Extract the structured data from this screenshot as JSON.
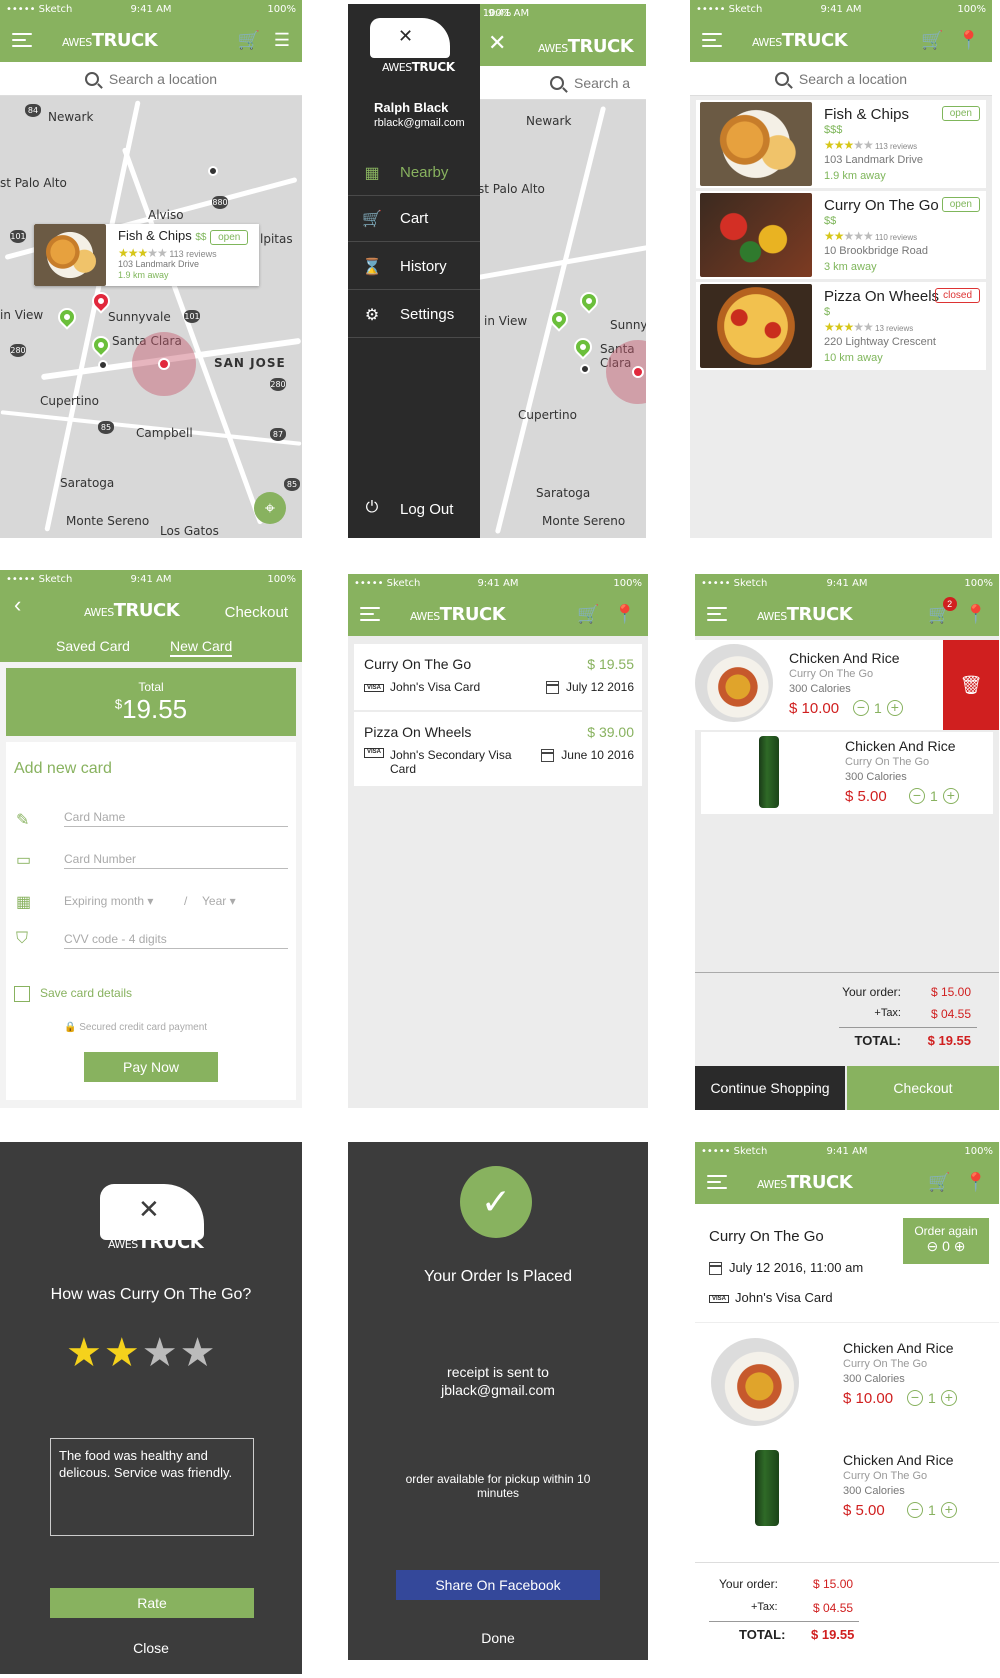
{
  "status": {
    "carrier": "••••• Sketch",
    "time": "9:41 AM",
    "battery": "100%"
  },
  "brand": {
    "logo_prefix": "AWES",
    "logo_main": "TRUCK",
    "accent": "#88b25f"
  },
  "search_placeholder": "Search a location",
  "map": {
    "cities": [
      "Newark",
      "st Palo Alto",
      "Alviso",
      "Sunnyvale",
      "Santa Clara",
      "SAN JOSE",
      "Cupertino",
      "Campbell",
      "Saratoga",
      "Monte Sereno",
      "Los Gatos",
      "in View"
    ],
    "shields": [
      "84",
      "880",
      "101",
      "101",
      "280",
      "85",
      "280",
      "87",
      "85"
    ],
    "callout": {
      "name": "Fish & Chips",
      "price": "$$",
      "status": "open",
      "reviews": "113 reviews",
      "address": "103 Landmark Drive",
      "distance": "1.9 km away"
    },
    "partial_label": "lpitas"
  },
  "side_menu": {
    "user_name": "Ralph Black",
    "user_email": "rblack@gmail.com",
    "items": [
      {
        "label": "Nearby",
        "icon": "map-icon"
      },
      {
        "label": "Cart",
        "icon": "cart-icon"
      },
      {
        "label": "History",
        "icon": "hourglass-icon"
      },
      {
        "label": "Settings",
        "icon": "gear-icon"
      }
    ],
    "logout": "Log Out",
    "search_partial": "Search a"
  },
  "list": [
    {
      "name": "Fish & Chips",
      "price": "$$$",
      "status": "open",
      "stars": 3,
      "reviews": "113 reviews",
      "address": "103 Landmark Drive",
      "distance": "1.9 km away"
    },
    {
      "name": "Curry On The Go",
      "price": "$$",
      "status": "open",
      "stars": 2,
      "reviews": "110 reviews",
      "address": "10 Brookbridge Road",
      "distance": "3 km away"
    },
    {
      "name": "Pizza On Wheels",
      "price": "$",
      "status": "closed",
      "stars": 3,
      "reviews": "13 reviews",
      "address": "220 Lightway Crescent",
      "distance": "10 km away"
    }
  ],
  "checkout": {
    "header": "Checkout",
    "tab_saved": "Saved Card",
    "tab_new": "New Card",
    "total_label": "Total",
    "total_currency": "$",
    "total_value": "19.55",
    "add_card": "Add new card",
    "card_name": "Card Name",
    "card_number": "Card Number",
    "exp_month": "Expiring month",
    "exp_year": "Year",
    "cvv": "CVV code - 4 digits",
    "save_details": "Save card details",
    "secured": "Secured credit card payment",
    "pay": "Pay Now"
  },
  "history": [
    {
      "name": "Curry On The Go",
      "amount": "$ 19.55",
      "card": "John's Visa Card",
      "date": "July 12 2016"
    },
    {
      "name": "Pizza On Wheels",
      "amount": "$ 39.00",
      "card": "John's Secondary Visa Card",
      "date": "June 10 2016"
    }
  ],
  "cart": {
    "badge": "2",
    "items": [
      {
        "name": "Chicken And Rice",
        "vendor": "Curry On The Go",
        "calories": "300 Calories",
        "price": "$ 10.00",
        "qty": "1"
      },
      {
        "name": "Chicken And Rice",
        "vendor": "Curry On The Go",
        "calories": "300 Calories",
        "price": "$ 5.00",
        "qty": "1"
      }
    ],
    "your_order_label": "Your order:",
    "your_order": "$ 15.00",
    "tax_label": "+Tax:",
    "tax": "$ 04.55",
    "total_label": "TOTAL:",
    "total": "$ 19.55",
    "continue": "Continue Shopping",
    "checkout": "Checkout"
  },
  "rating": {
    "question": "How was Curry On The Go?",
    "stars": 2,
    "review": "The food was healthy and delicous. Service was friendly.",
    "rate": "Rate",
    "close": "Close"
  },
  "placed": {
    "title": "Your Order Is Placed",
    "receipt_line1": "receipt is sent to",
    "receipt_line2": "jblack@gmail.com",
    "pickup": "order available for pickup within 10 minutes",
    "share": "Share On Facebook",
    "done": "Done"
  },
  "detail": {
    "vendor": "Curry On The Go",
    "order_again": "Order again",
    "order_again_qty": "0",
    "date": "July 12 2016, 11:00 am",
    "card": "John's Visa Card",
    "items": [
      {
        "name": "Chicken And Rice",
        "vendor": "Curry On The Go",
        "calories": "300 Calories",
        "price": "$ 10.00",
        "qty": "1"
      },
      {
        "name": "Chicken And Rice",
        "vendor": "Curry On The Go",
        "calories": "300 Calories",
        "price": "$ 5.00",
        "qty": "1"
      }
    ],
    "your_order_label": "Your order:",
    "your_order": "$ 15.00",
    "tax_label": "+Tax:",
    "tax": "$ 04.55",
    "total_label": "TOTAL:",
    "total": "$ 19.55"
  }
}
